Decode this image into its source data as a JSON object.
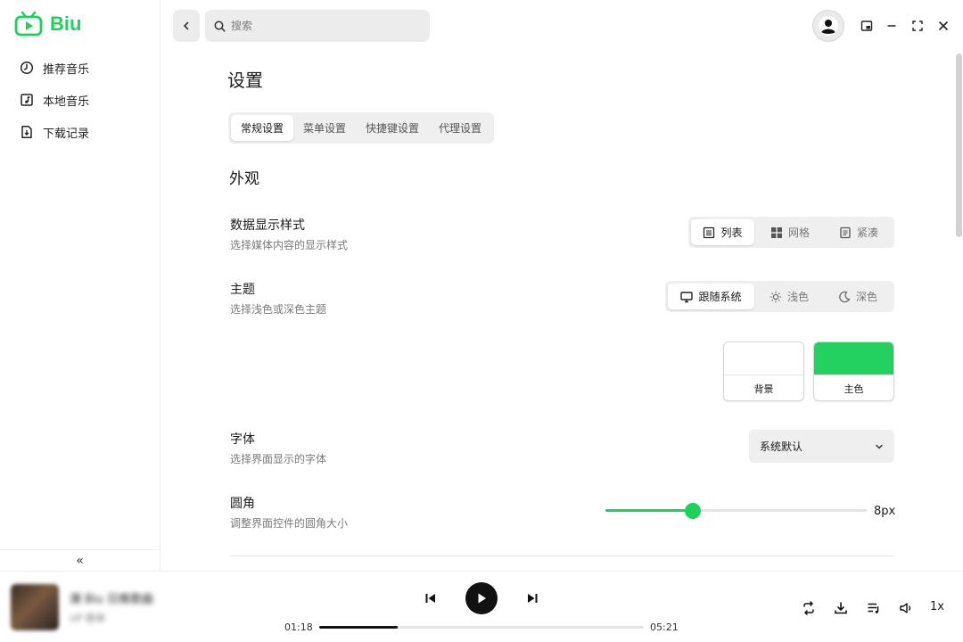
{
  "app": {
    "name": "Biu",
    "accent": "#1fd15a"
  },
  "sidebar": {
    "items": [
      {
        "label": "推荐音乐",
        "icon": "recommend-icon"
      },
      {
        "label": "本地音乐",
        "icon": "local-music-icon"
      },
      {
        "label": "下载记录",
        "icon": "download-record-icon"
      }
    ],
    "collapse_label": "«"
  },
  "topbar": {
    "search_placeholder": "搜索"
  },
  "settings": {
    "title": "设置",
    "tabs": [
      "常规设置",
      "菜单设置",
      "快捷键设置",
      "代理设置"
    ],
    "active_tab": 0,
    "section_title": "外观",
    "display_style": {
      "label": "数据显示样式",
      "desc": "选择媒体内容的显示样式",
      "options": [
        "列表",
        "网格",
        "紧凑"
      ],
      "selected": 0
    },
    "theme": {
      "label": "主题",
      "desc": "选择浅色或深色主题",
      "options": [
        "跟随系统",
        "浅色",
        "深色"
      ],
      "selected": 0
    },
    "colors": {
      "background_label": "背景",
      "background_color": "#ffffff",
      "primary_label": "主色",
      "primary_color": "#22d160"
    },
    "font": {
      "label": "字体",
      "desc": "选择界面显示的字体",
      "value": "系统默认"
    },
    "radius": {
      "label": "圆角",
      "desc": "调整界面控件的圆角大小",
      "value_label": "8px",
      "value": 8,
      "min": 0,
      "max": 24
    }
  },
  "player": {
    "track_title": "潮 Biu 日推歌曲",
    "track_artist": "UP 歌单",
    "current_time": "01:18",
    "total_time": "05:21",
    "progress": 0.243,
    "speed": "1x"
  }
}
